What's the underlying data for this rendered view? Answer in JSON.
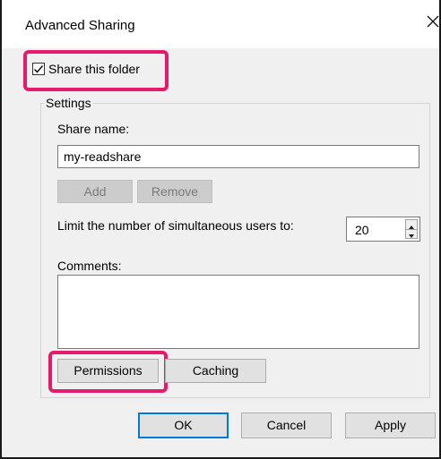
{
  "window": {
    "title": "Advanced Sharing",
    "close_glyph": "✕",
    "close_icon": "close-icon"
  },
  "share": {
    "checkbox_label": "Share this folder",
    "checked": true
  },
  "settings": {
    "group_label": "Settings",
    "share_name_label": "Share name:",
    "share_name_value": "my-readshare",
    "add_label": "Add",
    "remove_label": "Remove",
    "limit_label": "Limit the number of simultaneous users to:",
    "limit_value": "20",
    "comments_label": "Comments:",
    "comments_value": "",
    "permissions_label": "Permissions",
    "caching_label": "Caching"
  },
  "footer": {
    "ok_label": "OK",
    "cancel_label": "Cancel",
    "apply_label": "Apply"
  },
  "colors": {
    "highlight": "#e6196b",
    "default_button_border": "#0078d7",
    "dialog_bg": "#f0f0f0"
  }
}
